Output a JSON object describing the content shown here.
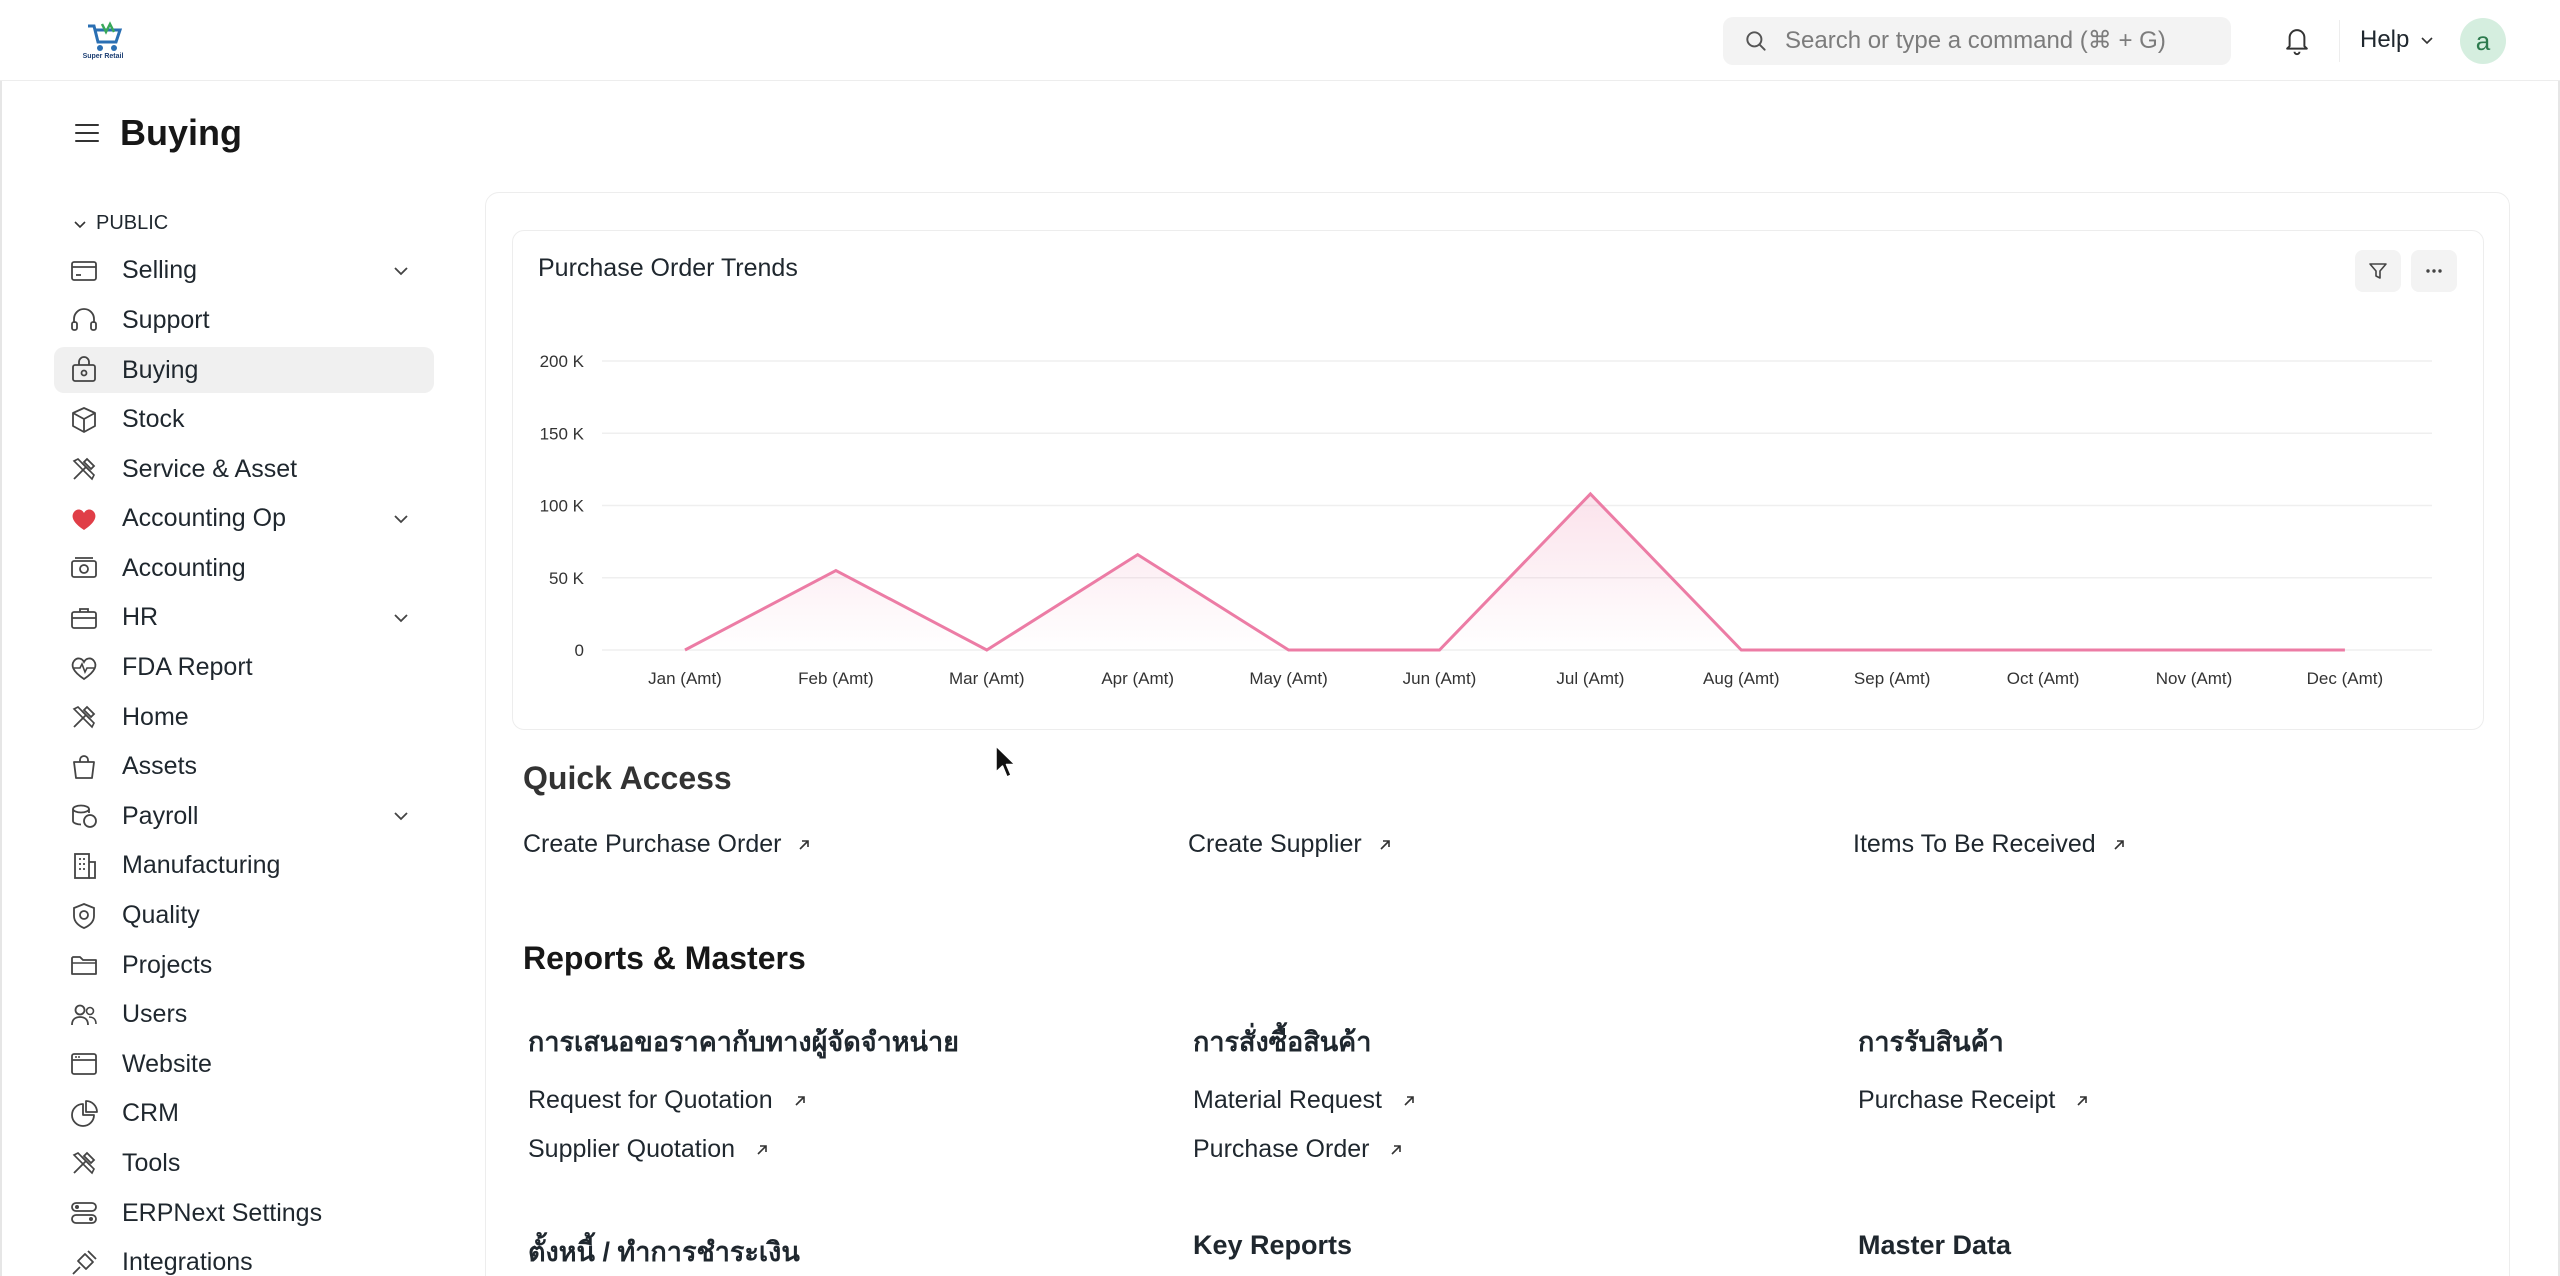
{
  "navbar": {
    "logo_text": "Super Retail",
    "search_placeholder": "Search or type a command (⌘ + G)",
    "help_label": "Help",
    "avatar_initial": "a"
  },
  "page": {
    "title": "Buying"
  },
  "sidebar": {
    "section_label": "PUBLIC",
    "items": [
      {
        "label": "Selling",
        "icon": "card-icon",
        "has_children": true
      },
      {
        "label": "Support",
        "icon": "headset-icon",
        "has_children": false
      },
      {
        "label": "Buying",
        "icon": "shopping-bag-icon",
        "has_children": false,
        "active": true
      },
      {
        "label": "Stock",
        "icon": "box-icon",
        "has_children": false
      },
      {
        "label": "Service & Asset",
        "icon": "tools-icon",
        "has_children": false
      },
      {
        "label": "Accounting Op",
        "icon": "heart-icon",
        "has_children": true
      },
      {
        "label": "Accounting",
        "icon": "money-icon",
        "has_children": false
      },
      {
        "label": "HR",
        "icon": "briefcase-icon",
        "has_children": true
      },
      {
        "label": "FDA Report",
        "icon": "heartbeat-icon",
        "has_children": false
      },
      {
        "label": "Home",
        "icon": "tools-icon",
        "has_children": false
      },
      {
        "label": "Assets",
        "icon": "bag-icon",
        "has_children": false
      },
      {
        "label": "Payroll",
        "icon": "coins-icon",
        "has_children": true
      },
      {
        "label": "Manufacturing",
        "icon": "building-icon",
        "has_children": false
      },
      {
        "label": "Quality",
        "icon": "quality-badge-icon",
        "has_children": false
      },
      {
        "label": "Projects",
        "icon": "folder-icon",
        "has_children": false
      },
      {
        "label": "Users",
        "icon": "users-icon",
        "has_children": false
      },
      {
        "label": "Website",
        "icon": "browser-icon",
        "has_children": false
      },
      {
        "label": "CRM",
        "icon": "pie-chart-icon",
        "has_children": false
      },
      {
        "label": "Tools",
        "icon": "tools-icon",
        "has_children": false
      },
      {
        "label": "ERPNext Settings",
        "icon": "settings-toggle-icon",
        "has_children": false
      },
      {
        "label": "Integrations",
        "icon": "plug-icon",
        "has_children": false
      }
    ]
  },
  "chart": {
    "title": "Purchase Order Trends",
    "line_color": "#ec7ca5"
  },
  "chart_data": {
    "type": "line",
    "title": "Purchase Order Trends",
    "categories": [
      "Jan (Amt)",
      "Feb (Amt)",
      "Mar (Amt)",
      "Apr (Amt)",
      "May (Amt)",
      "Jun (Amt)",
      "Jul (Amt)",
      "Aug (Amt)",
      "Sep (Amt)",
      "Oct (Amt)",
      "Nov (Amt)",
      "Dec (Amt)"
    ],
    "values": [
      0,
      55000,
      0,
      66000,
      0,
      0,
      108000,
      0,
      0,
      0,
      0,
      0
    ],
    "y_ticks": [
      0,
      50000,
      100000,
      150000,
      200000
    ],
    "y_tick_labels": [
      "0",
      "50 K",
      "100 K",
      "150 K",
      "200 K"
    ],
    "ylim": [
      0,
      200000
    ],
    "grid": true,
    "area_fill": true
  },
  "quick_access": {
    "heading": "Quick Access",
    "links": [
      "Create Purchase Order",
      "Create Supplier",
      "Items To Be Received"
    ]
  },
  "reports": {
    "heading": "Reports & Masters",
    "groups": [
      {
        "title": "การเสนอขอราคากับทางผู้จัดจำหน่าย",
        "links": [
          "Request for Quotation",
          "Supplier Quotation"
        ]
      },
      {
        "title": "การสั่งซื้อสินค้า",
        "links": [
          "Material Request",
          "Purchase Order"
        ]
      },
      {
        "title": "การรับสินค้า",
        "links": [
          "Purchase Receipt"
        ]
      },
      {
        "title": "ตั้งหนี้ / ทำการชำระเงิน",
        "links": []
      },
      {
        "title": "Key Reports",
        "links": []
      },
      {
        "title": "Master Data",
        "links": []
      }
    ]
  }
}
